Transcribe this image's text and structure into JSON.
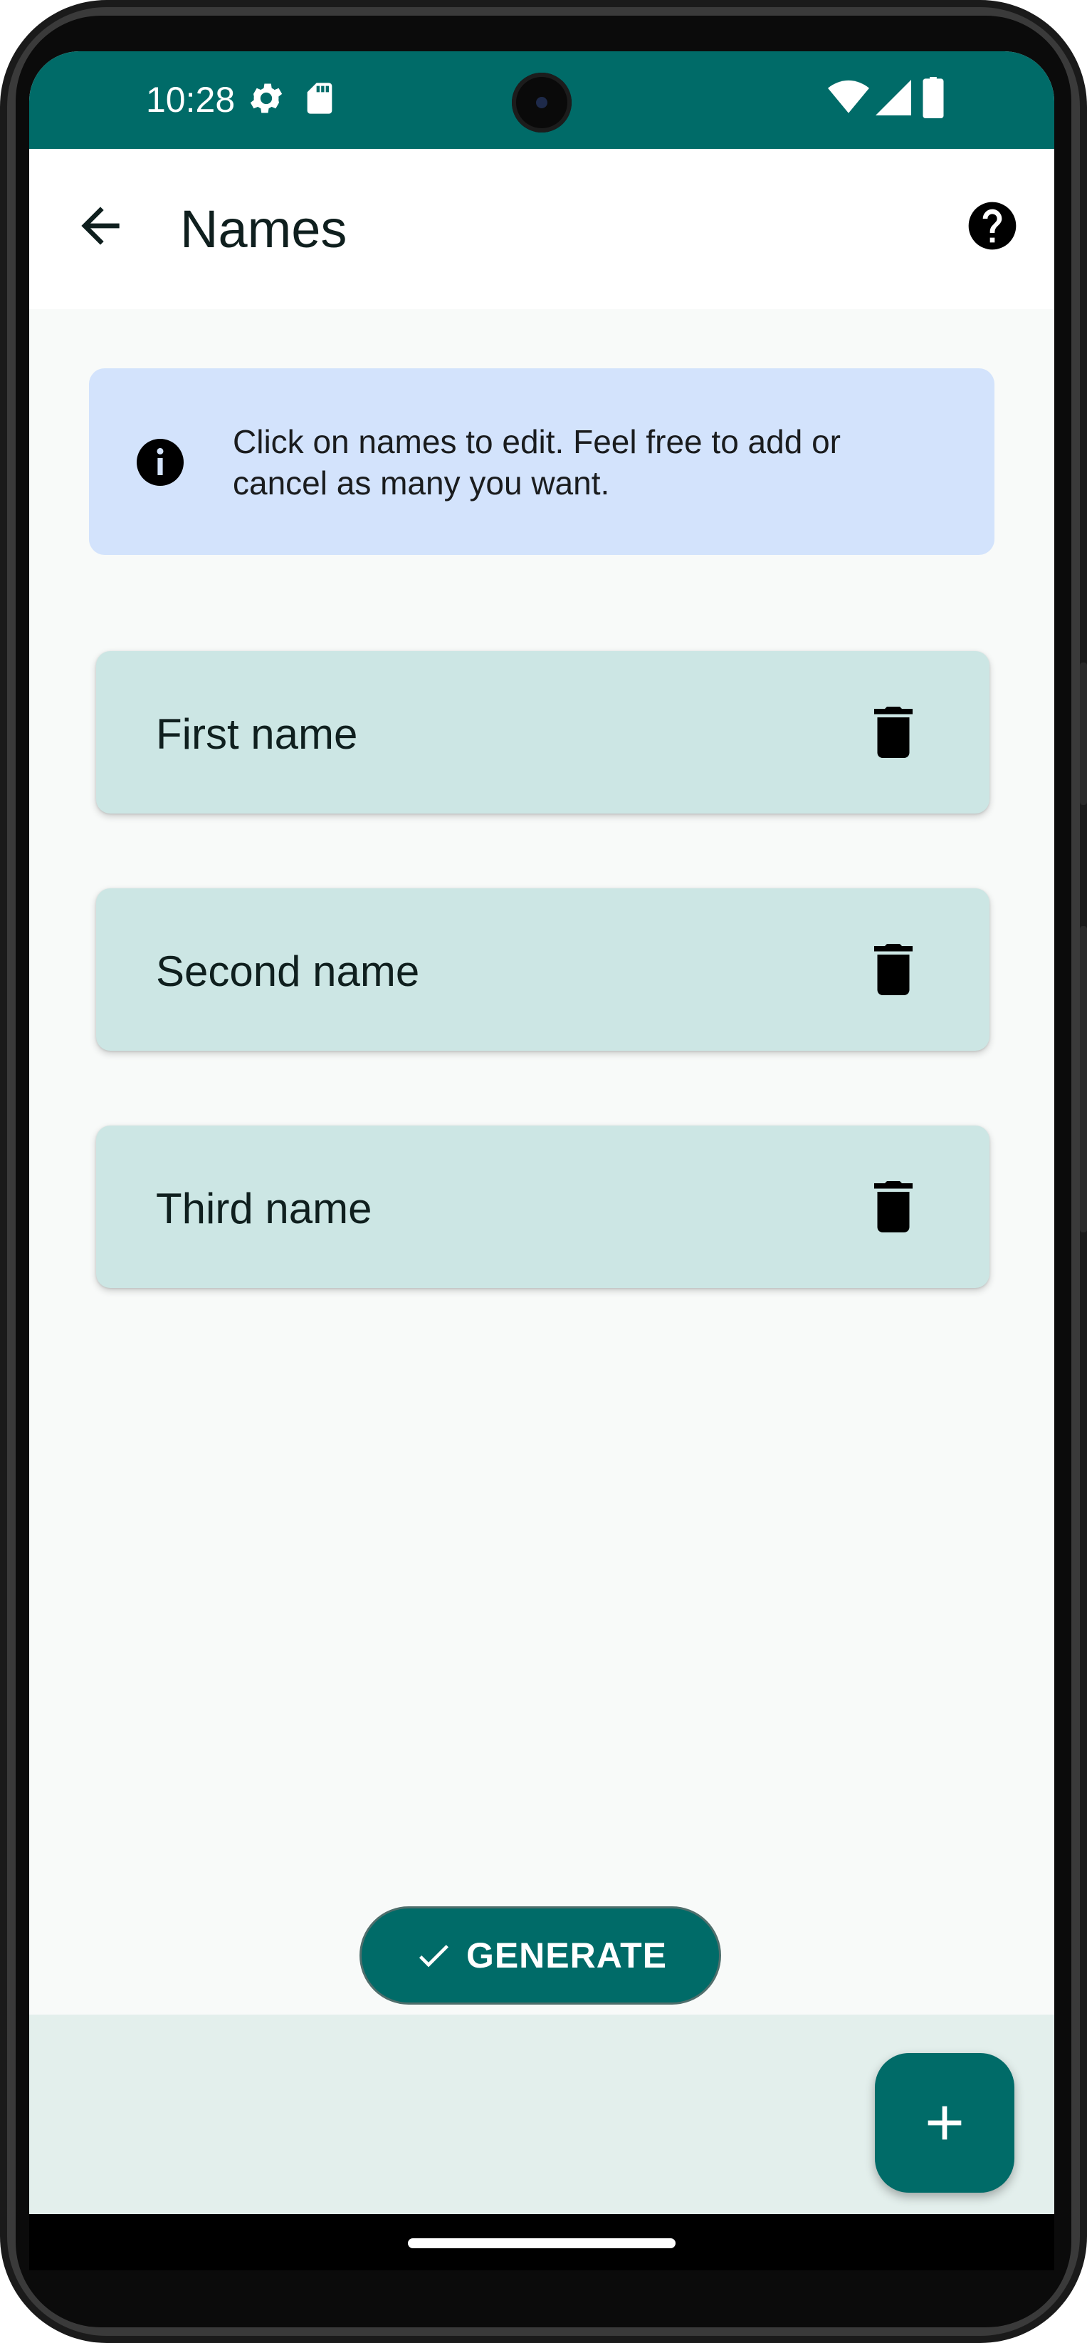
{
  "status_bar": {
    "time": "10:28",
    "icons": [
      "settings-gear-icon",
      "sd-card-icon",
      "wifi-icon",
      "cell-signal-icon",
      "battery-icon"
    ],
    "color": "#006b68"
  },
  "app_bar": {
    "title": "Names",
    "back_icon": "arrow-back-icon",
    "help_icon": "help-circle-icon"
  },
  "info_banner": {
    "text": "Click on names to edit. Feel free to add or cancel as many you want.",
    "icon": "info-icon",
    "background": "#d3e3fc"
  },
  "names": [
    {
      "label": "First name",
      "action_icon": "trash-icon"
    },
    {
      "label": "Second name",
      "action_icon": "trash-icon"
    },
    {
      "label": "Third name",
      "action_icon": "trash-icon"
    }
  ],
  "generate_button": {
    "label": "GENERATE",
    "icon": "check-icon"
  },
  "fab": {
    "icon": "plus-icon"
  },
  "colors": {
    "primary": "#006b68",
    "card": "#cce6e4",
    "surface": "#f8faf9"
  }
}
